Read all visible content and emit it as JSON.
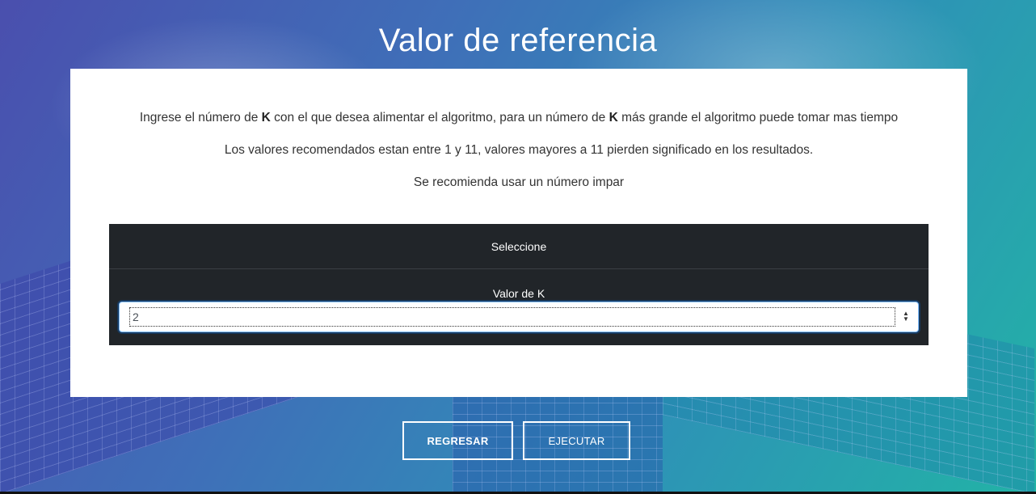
{
  "page": {
    "title": "Valor de referencia"
  },
  "intro": {
    "line1_a": "Ingrese el número de ",
    "line1_k1": "K",
    "line1_b": " con el que desea alimentar el algoritmo, para un número de ",
    "line1_k2": "K",
    "line1_c": " más grande el algoritmo puede tomar mas tiempo",
    "line2": "Los valores recomendados estan entre 1 y 11, valores mayores a 11 pierden significado en los resultados.",
    "line3": "Se recomienda usar un número impar"
  },
  "panel": {
    "header": "Seleccione",
    "field_label": "Valor de K",
    "selected_value": "2"
  },
  "actions": {
    "back_label": "REGRESAR",
    "run_label": "EJECUTAR"
  },
  "colors": {
    "panel_bg": "#212529",
    "card_bg": "#ffffff",
    "focus_ring": "#80bdff"
  }
}
